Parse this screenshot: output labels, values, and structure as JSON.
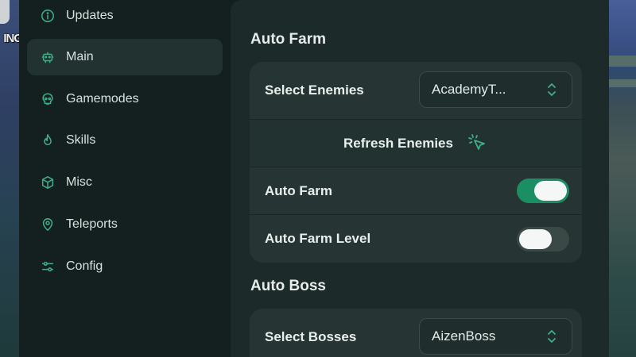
{
  "background": {
    "game_text": "ING"
  },
  "sidebar": {
    "items": [
      {
        "label": "Updates",
        "icon": "info-icon",
        "active": false
      },
      {
        "label": "Main",
        "icon": "robot-icon",
        "active": true
      },
      {
        "label": "Gamemodes",
        "icon": "skull-icon",
        "active": false
      },
      {
        "label": "Skills",
        "icon": "flame-icon",
        "active": false
      },
      {
        "label": "Misc",
        "icon": "cube-icon",
        "active": false
      },
      {
        "label": "Teleports",
        "icon": "map-pin-icon",
        "active": false
      },
      {
        "label": "Config",
        "icon": "sliders-icon",
        "active": false
      }
    ]
  },
  "main": {
    "auto_farm": {
      "title": "Auto Farm",
      "select_enemies_label": "Select Enemies",
      "select_enemies_value": "AcademyT...",
      "refresh_label": "Refresh Enemies",
      "auto_farm_label": "Auto Farm",
      "auto_farm_on": true,
      "auto_farm_level_label": "Auto Farm Level",
      "auto_farm_level_on": false
    },
    "auto_boss": {
      "title": "Auto Boss",
      "select_bosses_label": "Select Bosses",
      "select_bosses_value": "AizenBoss"
    }
  },
  "colors": {
    "accent": "#1b8f63",
    "window_bg": "#13201f",
    "content_bg": "#1c2a29",
    "card_bg": "#263533",
    "icon": "#3fae86"
  }
}
